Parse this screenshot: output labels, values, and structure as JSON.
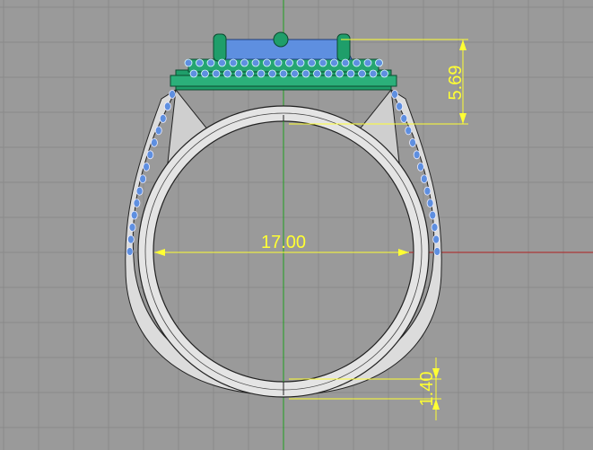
{
  "viewport": {
    "background": "#9a9a9a",
    "grid_color": "#8a8a8a",
    "axis_colors": {
      "x": "#b02020",
      "y": "#20a020"
    },
    "dimension_color": "#ffff33"
  },
  "model": {
    "band_color": "#e4e4e4",
    "setting_color": "#1f9e6a",
    "stone_color": "#5e8fe0",
    "edge_color": "#222222"
  },
  "dimensions": {
    "inner_diameter": "17.00",
    "top_height": "5.69",
    "band_thickness": "1.40"
  }
}
